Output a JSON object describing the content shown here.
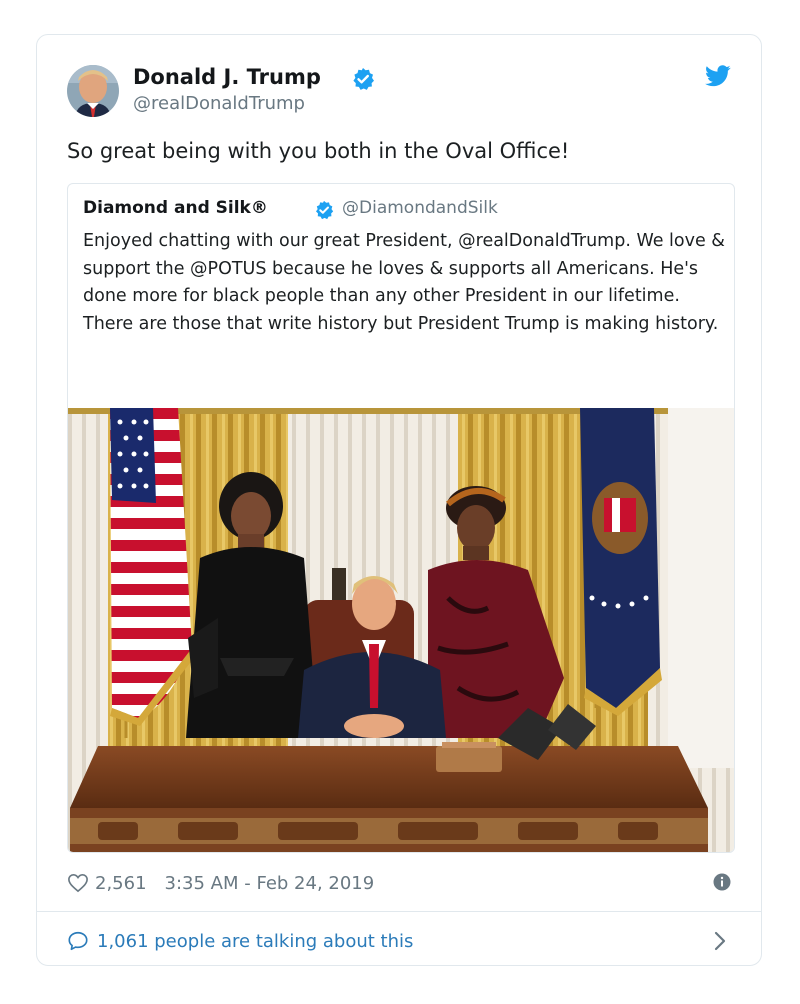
{
  "tweet": {
    "author_name": "Donald J. Trump",
    "author_handle": "@realDonaldTrump",
    "text": "So great being with you both in the Oval Office!",
    "likes": "2,561",
    "timestamp": "3:35 AM - Feb 24, 2019",
    "talking": "1,061 people are talking about this"
  },
  "quoted": {
    "author_name": "Diamond and Silk®",
    "author_handle": "@DiamondandSilk",
    "text": "Enjoyed chatting with our great President, @realDonaldTrump. We love & support the @POTUS because he loves & supports all Americans. He's done more for black people than any other President in our lifetime. There are those that write history but President Trump is making history."
  },
  "icons": {
    "verified": "verified-badge-icon",
    "bird": "twitter-bird-icon",
    "heart": "heart-icon",
    "info": "info-icon",
    "bubble": "speech-bubble-icon",
    "chevron": "chevron-right-icon"
  },
  "colors": {
    "link": "#2b7bb9",
    "brand": "#1da1f2",
    "muted": "#697882",
    "border": "#e1e8ed"
  }
}
